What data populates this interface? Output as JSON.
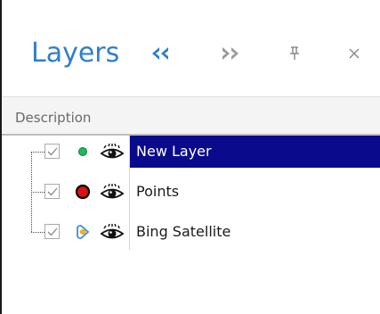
{
  "panel": {
    "title": "Layers",
    "buttons": {
      "collapse_icon": "double-chevron-left-icon",
      "expand_icon": "double-chevron-right-icon",
      "pin_icon": "pin-icon",
      "close_icon": "close-icon"
    }
  },
  "columns": {
    "description": "Description"
  },
  "layers": [
    {
      "label": "New Layer",
      "checked": true,
      "layer_icon": "green-dot-icon",
      "visibility_icon": "eye-icon",
      "selected": true
    },
    {
      "label": "Points",
      "checked": true,
      "layer_icon": "red-point-icon",
      "visibility_icon": "eye-icon",
      "selected": false
    },
    {
      "label": "Bing Satellite",
      "checked": true,
      "layer_icon": "satellite-imagery-icon",
      "visibility_icon": "eye-icon",
      "selected": false
    }
  ],
  "colors": {
    "title": "#2f7fcc",
    "accent_buttons_active": "#2f7fcc",
    "accent_buttons_inactive": "#9a9a9a",
    "selection": "#0a0a8c",
    "green_dot": "#1fb95a",
    "red_point": "#e01010"
  }
}
